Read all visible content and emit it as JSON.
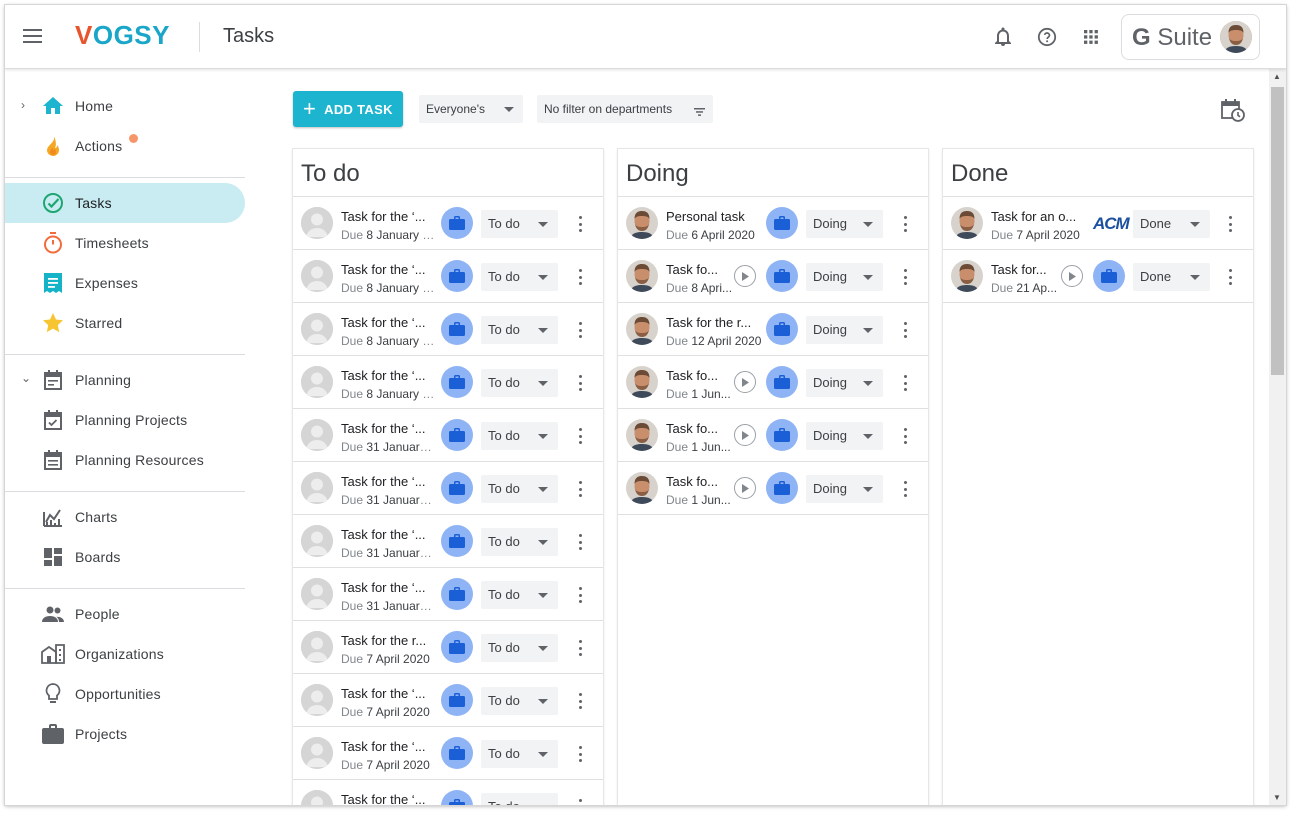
{
  "header": {
    "logo_v": "V",
    "logo_rest": "OGSY",
    "title": "Tasks",
    "gsuite_g": "G",
    "gsuite_text": " Suite",
    "icons": [
      "menu-icon",
      "bell-icon",
      "help-icon",
      "apps-icon"
    ]
  },
  "sidebar": {
    "home": "Home",
    "actions": "Actions",
    "tasks": "Tasks",
    "timesheets": "Timesheets",
    "expenses": "Expenses",
    "starred": "Starred",
    "planning": "Planning",
    "planning_projects": "Planning Projects",
    "planning_resources": "Planning Resources",
    "charts": "Charts",
    "boards": "Boards",
    "people": "People",
    "organizations": "Organizations",
    "opportunities": "Opportunities",
    "projects": "Projects"
  },
  "toolbar": {
    "add_task": "ADD TASK",
    "owner_filter": "Everyone's",
    "department_filter": "No filter on departments"
  },
  "colors": {
    "accent": "#1cb4cf",
    "active_nav": "#c8ecf2",
    "briefcase": "#8fb4f5",
    "actions_dot": "#f7966b"
  },
  "columns": {
    "todo": {
      "title": "To do",
      "cards": [
        {
          "name": "Task for the ‘...",
          "due_prefix": "Due",
          "due": "8 January 2...",
          "status": "To do"
        },
        {
          "name": "Task for the ‘...",
          "due_prefix": "Due",
          "due": "8 January 2...",
          "status": "To do"
        },
        {
          "name": "Task for the ‘...",
          "due_prefix": "Due",
          "due": "8 January 2...",
          "status": "To do"
        },
        {
          "name": "Task for the ‘...",
          "due_prefix": "Due",
          "due": "8 January 2...",
          "status": "To do"
        },
        {
          "name": "Task for the ‘...",
          "due_prefix": "Due",
          "due": "31 January ...",
          "status": "To do"
        },
        {
          "name": "Task for the ‘...",
          "due_prefix": "Due",
          "due": "31 January ...",
          "status": "To do"
        },
        {
          "name": "Task for the ‘...",
          "due_prefix": "Due",
          "due": "31 January ...",
          "status": "To do"
        },
        {
          "name": "Task for the ‘...",
          "due_prefix": "Due",
          "due": "31 January ...",
          "status": "To do"
        },
        {
          "name": "Task for the r...",
          "due_prefix": "Due",
          "due": "7 April 2020",
          "status": "To do"
        },
        {
          "name": "Task for the ‘...",
          "due_prefix": "Due",
          "due": "7 April 2020",
          "status": "To do"
        },
        {
          "name": "Task for the ‘...",
          "due_prefix": "Due",
          "due": "7 April 2020",
          "status": "To do"
        },
        {
          "name": "Task for the ‘...",
          "due_prefix": "Due",
          "due": "",
          "status": "To do"
        }
      ]
    },
    "doing": {
      "title": "Doing",
      "cards": [
        {
          "name": "Personal task",
          "due_prefix": "Due",
          "due": "6 April 2020",
          "status": "Doing"
        },
        {
          "name": "Task fo...",
          "due_prefix": "Due",
          "due": "8 Apri...",
          "status": "Doing"
        },
        {
          "name": "Task for the r...",
          "due_prefix": "Due",
          "due": "12 April 2020",
          "status": "Doing"
        },
        {
          "name": "Task fo...",
          "due_prefix": "Due",
          "due": "1 Jun...",
          "status": "Doing"
        },
        {
          "name": "Task fo...",
          "due_prefix": "Due",
          "due": "1 Jun...",
          "status": "Doing"
        },
        {
          "name": "Task fo...",
          "due_prefix": "Due",
          "due": "1 Jun...",
          "status": "Doing"
        }
      ]
    },
    "done": {
      "title": "Done",
      "cards": [
        {
          "name": "Task for an o...",
          "due_prefix": "Due",
          "due": "7 April 2020",
          "status": "Done",
          "org_logo": "ACM"
        },
        {
          "name": "Task for...",
          "due_prefix": "Due",
          "due": "21 Ap...",
          "status": "Done"
        }
      ]
    }
  }
}
